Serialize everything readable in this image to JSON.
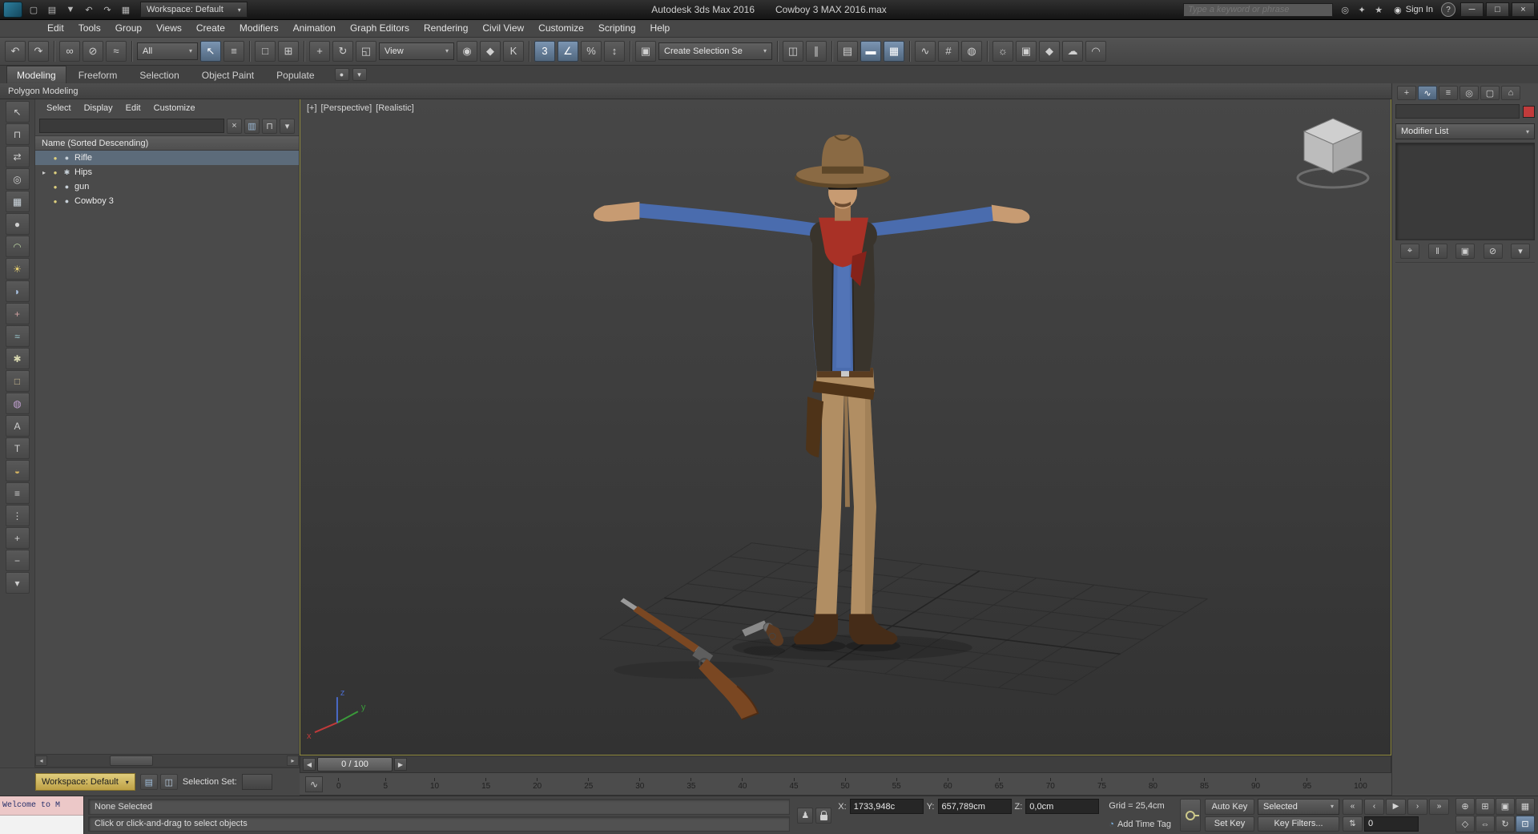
{
  "titlebar": {
    "app_title": "Autodesk 3ds Max 2016",
    "doc_title": "Cowboy 3 MAX 2016.max",
    "workspace": "Workspace: Default",
    "search_placeholder": "Type a keyword or phrase",
    "sign_in": "Sign In",
    "quick_access": [
      {
        "name": "new-scene-icon",
        "glyph": "▢"
      },
      {
        "name": "open-file-icon",
        "glyph": "▤"
      },
      {
        "name": "save-file-icon",
        "glyph": "▼"
      },
      {
        "name": "undo-icon",
        "glyph": "↶"
      },
      {
        "name": "redo-icon",
        "glyph": "↷"
      },
      {
        "name": "project-folder-icon",
        "glyph": "▦"
      }
    ],
    "right_icons": [
      {
        "name": "search-go-icon",
        "glyph": "◎"
      },
      {
        "name": "communication-center-icon",
        "glyph": "✦"
      },
      {
        "name": "favorites-icon",
        "glyph": "★"
      }
    ],
    "avatar_glyph": "◉",
    "help_glyph": "?",
    "window_buttons": [
      {
        "name": "minimize-button",
        "glyph": "─"
      },
      {
        "name": "maximize-button",
        "glyph": "□"
      },
      {
        "name": "close-button",
        "glyph": "×"
      }
    ]
  },
  "menubar": {
    "items": [
      "Edit",
      "Tools",
      "Group",
      "Views",
      "Create",
      "Modifiers",
      "Animation",
      "Graph Editors",
      "Rendering",
      "Civil View",
      "Customize",
      "Scripting",
      "Help"
    ]
  },
  "toolbar": {
    "filter_value": "All",
    "coord_system": "View",
    "selection_set": "Create Selection Se",
    "g_undo": [
      {
        "name": "undo-icon",
        "glyph": "↶"
      },
      {
        "name": "redo-icon",
        "glyph": "↷"
      }
    ],
    "g_link": [
      {
        "name": "select-and-link-icon",
        "glyph": "∞"
      },
      {
        "name": "unlink-selection-icon",
        "glyph": "⊘"
      },
      {
        "name": "bind-to-space-warp-icon",
        "glyph": "≈"
      }
    ],
    "g_select": [
      {
        "name": "select-object-icon",
        "glyph": "↖",
        "active": true
      },
      {
        "name": "select-by-name-icon",
        "glyph": "≡"
      }
    ],
    "g_region": [
      {
        "name": "rectangular-selection-region-icon",
        "glyph": "□"
      },
      {
        "name": "window-crossing-icon",
        "glyph": "⊞"
      }
    ],
    "g_transform": [
      {
        "name": "select-and-move-icon",
        "glyph": "+"
      },
      {
        "name": "select-and-rotate-icon",
        "glyph": "↻"
      },
      {
        "name": "select-and-scale-icon",
        "glyph": "◱"
      }
    ],
    "g_pivot": [
      {
        "name": "use-pivot-point-center-icon",
        "glyph": "◉"
      },
      {
        "name": "select-and-manipulate-icon",
        "glyph": "◆"
      },
      {
        "name": "keyboard-shortcut-override-icon",
        "glyph": "K"
      }
    ],
    "g_snap": [
      {
        "name": "snaps-toggle-3d-icon",
        "glyph": "3",
        "active": true
      },
      {
        "name": "angle-snap-icon",
        "glyph": "∠",
        "active": true
      },
      {
        "name": "percent-snap-icon",
        "glyph": "%"
      },
      {
        "name": "spinner-snap-icon",
        "glyph": "↕"
      }
    ],
    "g_selset": [
      {
        "name": "edit-named-selection-sets-icon",
        "glyph": "▣"
      }
    ],
    "g_mirror": [
      {
        "name": "mirror-icon",
        "glyph": "◫"
      },
      {
        "name": "align-icon",
        "glyph": "∥"
      }
    ],
    "g_manage": [
      {
        "name": "layer-manager-icon",
        "glyph": "▤"
      },
      {
        "name": "ribbon-toggle-icon",
        "glyph": "▬",
        "active": true
      },
      {
        "name": "scene-explorer-toggle-icon",
        "glyph": "▦",
        "active": true
      }
    ],
    "g_editors": [
      {
        "name": "curve-editor-icon",
        "glyph": "∿"
      },
      {
        "name": "schematic-view-icon",
        "glyph": "#"
      },
      {
        "name": "material-editor-icon",
        "glyph": "◍"
      }
    ],
    "g_render": [
      {
        "name": "render-setup-icon",
        "glyph": "☼"
      },
      {
        "name": "rendered-frame-window-icon",
        "glyph": "▣"
      },
      {
        "name": "render-production-icon",
        "glyph": "◆"
      },
      {
        "name": "render-in-cloud-icon",
        "glyph": "☁"
      },
      {
        "name": "open-gallery-icon",
        "glyph": "◠"
      }
    ]
  },
  "ribbon": {
    "tabs": [
      {
        "label": "Modeling",
        "active": true
      },
      {
        "label": "Freeform"
      },
      {
        "label": "Selection"
      },
      {
        "label": "Object Paint"
      },
      {
        "label": "Populate"
      }
    ],
    "extra_icons": [
      {
        "name": "ribbon-config-icon",
        "glyph": "●"
      },
      {
        "name": "ribbon-minimize-icon",
        "glyph": "▾"
      }
    ],
    "panel_label": "Polygon Modeling"
  },
  "explorer": {
    "menus": [
      "Select",
      "Display",
      "Edit",
      "Customize"
    ],
    "search_value": "",
    "search_icons": [
      {
        "name": "clear-search-icon",
        "glyph": "×"
      },
      {
        "name": "column-chooser-icon",
        "glyph": "▥",
        "color": "#9dbbd8"
      },
      {
        "name": "lock-explorer-icon",
        "glyph": "⊓"
      },
      {
        "name": "explorer-settings-icon",
        "glyph": "▾"
      }
    ],
    "header": "Name (Sorted Descending)",
    "bulb_glyph": "●",
    "rows": [
      {
        "expander": "",
        "icon": "●",
        "label": "Rifle"
      },
      {
        "expander": "▸",
        "icon": "✱",
        "label": "Hips"
      },
      {
        "expander": "",
        "icon": "●",
        "label": "gun"
      },
      {
        "expander": "",
        "icon": "●",
        "label": "Cowboy 3"
      }
    ],
    "hscroll": {
      "left": "◂",
      "right": "▸"
    },
    "side_icons": [
      {
        "name": "pick-parent-icon",
        "glyph": "↖"
      },
      {
        "name": "lock-cell-editing-icon",
        "glyph": "⊓"
      },
      {
        "name": "sync-selection-icon",
        "glyph": "⇄"
      },
      {
        "name": "find-icon",
        "glyph": "◎"
      },
      {
        "name": "display-all-icon",
        "glyph": "▦",
        "color": "#cfd8e0"
      },
      {
        "name": "display-geometry-icon",
        "glyph": "●",
        "color": "#cfcfcf"
      },
      {
        "name": "display-shapes-icon",
        "glyph": "◠",
        "color": "#b8d0a0"
      },
      {
        "name": "display-lights-icon",
        "glyph": "☀",
        "color": "#e8d070"
      },
      {
        "name": "display-cameras-icon",
        "glyph": "◗",
        "color": "#a8c0e0"
      },
      {
        "name": "display-helpers-icon",
        "glyph": "+",
        "color": "#d0a0a0"
      },
      {
        "name": "display-spacewarps-icon",
        "glyph": "≈",
        "color": "#9fd0d8"
      },
      {
        "name": "display-bones-icon",
        "glyph": "✱",
        "color": "#d8d8b0"
      },
      {
        "name": "display-containers-icon",
        "glyph": "□",
        "color": "#c8b890"
      },
      {
        "name": "display-materials-icon",
        "glyph": "◍",
        "color": "#c0a0d0"
      },
      {
        "name": "sort-alphabetical-icon",
        "glyph": "A"
      },
      {
        "name": "sort-by-type-icon",
        "glyph": "T"
      },
      {
        "name": "sort-by-color-icon",
        "glyph": "◒",
        "color": "#d0b060"
      },
      {
        "name": "view-list-icon",
        "glyph": "≡"
      },
      {
        "name": "view-hierarchy-icon",
        "glyph": "⋮"
      },
      {
        "name": "expand-all-icon",
        "glyph": "+"
      },
      {
        "name": "collapse-all-icon",
        "glyph": "−"
      },
      {
        "name": "explorer-config-icon",
        "glyph": "▾"
      }
    ],
    "workspace_label": "Workspace: Default",
    "workspace_icons": [
      {
        "name": "layers-toolbar-icon",
        "glyph": "▤",
        "color": "#9dbbd8"
      },
      {
        "name": "selection-sets-icon",
        "glyph": "◫",
        "color": "#b9cde0"
      }
    ],
    "selection_set_label": "Selection Set:"
  },
  "viewport": {
    "labels": {
      "plus": "[+]",
      "view": "[Perspective]",
      "shading": "[Realistic]"
    },
    "axis": {
      "x": "x",
      "y": "y",
      "z": "z"
    }
  },
  "scene": {
    "objects": [
      "Cowboy 3",
      "Rifle",
      "gun"
    ],
    "colors": {
      "hat": "#8a6a44",
      "hat_dark": "#5e4729",
      "skin": "#c79b72",
      "skin_dark": "#a87c54",
      "scarf": "#a93126",
      "scarf_dark": "#85221a",
      "shirt": "#4a6cae",
      "shirt_dark": "#3a5590",
      "vest": "#39342c",
      "vest_dark": "#2b2721",
      "belt": "#5a3c20",
      "pants": "#b18e63",
      "pants_dark": "#94744e",
      "boots": "#452c18",
      "holster": "#4e3318",
      "wood": "#7a4722",
      "metal": "#9a9a9a",
      "grid_line": "#2d2d2d",
      "grid_axis": "#242424"
    }
  },
  "timeline": {
    "slider_label": "0 / 100",
    "prev_glyph": "◀",
    "next_glyph": "▶",
    "curve_button_glyph": "∿",
    "ticks": [
      "0",
      "5",
      "10",
      "15",
      "20",
      "25",
      "30",
      "35",
      "40",
      "45",
      "50",
      "55",
      "60",
      "65",
      "70",
      "75",
      "80",
      "85",
      "90",
      "95",
      "100"
    ]
  },
  "command_panel": {
    "tabs": [
      {
        "name": "tab-create-icon",
        "glyph": "+"
      },
      {
        "name": "tab-modify-icon",
        "glyph": "∿",
        "active": true
      },
      {
        "name": "tab-hierarchy-icon",
        "glyph": "≡"
      },
      {
        "name": "tab-motion-icon",
        "glyph": "◎"
      },
      {
        "name": "tab-display-icon",
        "glyph": "▢"
      },
      {
        "name": "tab-utilities-icon",
        "glyph": "⌂"
      }
    ],
    "name_value": "",
    "object_color": "#c23b3b",
    "modifier_list_label": "Modifier List",
    "stack_buttons": [
      {
        "name": "pin-stack-icon",
        "glyph": "⌖"
      },
      {
        "name": "show-end-result-icon",
        "glyph": "‖"
      },
      {
        "name": "make-unique-icon",
        "glyph": "▣"
      },
      {
        "name": "remove-modifier-icon",
        "glyph": "⊘"
      },
      {
        "name": "configure-modifier-sets-icon",
        "glyph": "▾"
      }
    ]
  },
  "statusbar": {
    "listener_text": "Welcome to M",
    "selection_status": "None Selected",
    "prompt": "Click or click-and-drag to select objects",
    "coords": {
      "x_label": "X:",
      "x_value": "1733,948c",
      "y_label": "Y:",
      "y_value": "657,789cm",
      "z_label": "Z:",
      "z_value": "0,0cm"
    },
    "grid_text": "Grid = 25,4cm",
    "add_time_tag": "Add Time Tag",
    "timetag_glyph": "◔",
    "isolate_glyph": "♟",
    "auto_key": "Auto Key",
    "set_key": "Set Key",
    "key_mode": "Selected",
    "key_filters": "Key Filters...",
    "frame_value": "0",
    "transport": [
      {
        "name": "go-to-start-button",
        "glyph": "«"
      },
      {
        "name": "previous-frame-button",
        "glyph": "‹"
      },
      {
        "name": "play-button",
        "glyph": "▶"
      },
      {
        "name": "next-frame-button",
        "glyph": "›"
      },
      {
        "name": "go-to-end-button",
        "glyph": "»"
      }
    ],
    "key_step_glyph": "⇅",
    "nav_icons": [
      {
        "name": "zoom-icon",
        "glyph": "⊕"
      },
      {
        "name": "zoom-all-icon",
        "glyph": "⊞"
      },
      {
        "name": "zoom-extents-icon",
        "glyph": "▣"
      },
      {
        "name": "zoom-extents-all-icon",
        "glyph": "▦"
      },
      {
        "name": "field-of-view-icon",
        "glyph": "◇"
      },
      {
        "name": "pan-icon",
        "glyph": "⇔"
      },
      {
        "name": "orbit-icon",
        "glyph": "↻"
      },
      {
        "name": "maximize-viewport-icon",
        "glyph": "⊡",
        "active": true
      }
    ]
  }
}
